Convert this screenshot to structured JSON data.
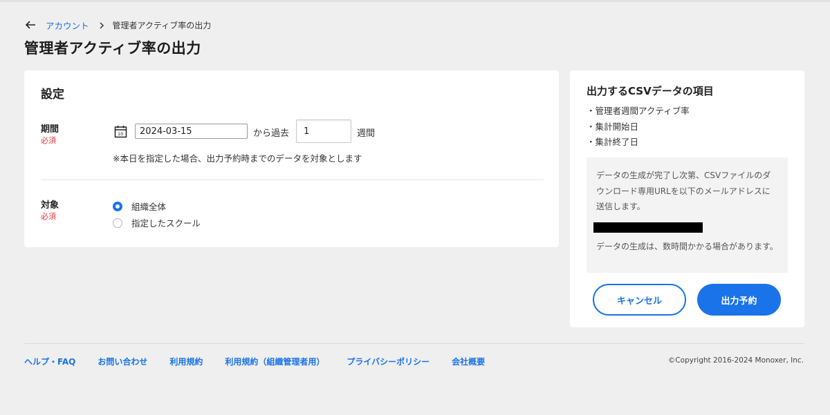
{
  "breadcrumb": {
    "back_icon": "arrow-left-icon",
    "link": "アカウント",
    "separator_icon": "chevron-right-icon",
    "current": "管理者アクティブ率の出力"
  },
  "page_title": "管理者アクティブ率の出力",
  "settings": {
    "title": "設定",
    "period": {
      "label": "期間",
      "required": "必須",
      "calendar_icon": "calendar-icon",
      "date_value": "2024-03-15",
      "from_past": "から過去",
      "weeks_value": "1",
      "weeks_unit": "週間",
      "note": "※本日を指定した場合、出力予約時までのデータを対象とします"
    },
    "target": {
      "label": "対象",
      "required": "必須",
      "options": [
        {
          "label": "組織全体",
          "selected": true
        },
        {
          "label": "指定したスクール",
          "selected": false
        }
      ]
    }
  },
  "csv_panel": {
    "title": "出力するCSVデータの項目",
    "items": [
      "・管理者週間アクティブ率",
      "・集計開始日",
      "・集計終了日"
    ],
    "info_text": "データの生成が完了し次第、CSVファイルのダウンロード専用URLを以下のメールアドレスに送信します。",
    "info_note": "データの生成は、数時間かかる場合があります。",
    "cancel_label": "キャンセル",
    "submit_label": "出力予約"
  },
  "footer": {
    "links": [
      "ヘルプ・FAQ",
      "お問い合わせ",
      "利用規約",
      "利用規約（組織管理者用）",
      "プライバシーポリシー",
      "会社概要"
    ],
    "copyright": "©Copyright 2016-2024 Monoxer, Inc."
  },
  "colors": {
    "accent": "#1a73e8",
    "required": "#e0393e",
    "background": "#efefef"
  }
}
